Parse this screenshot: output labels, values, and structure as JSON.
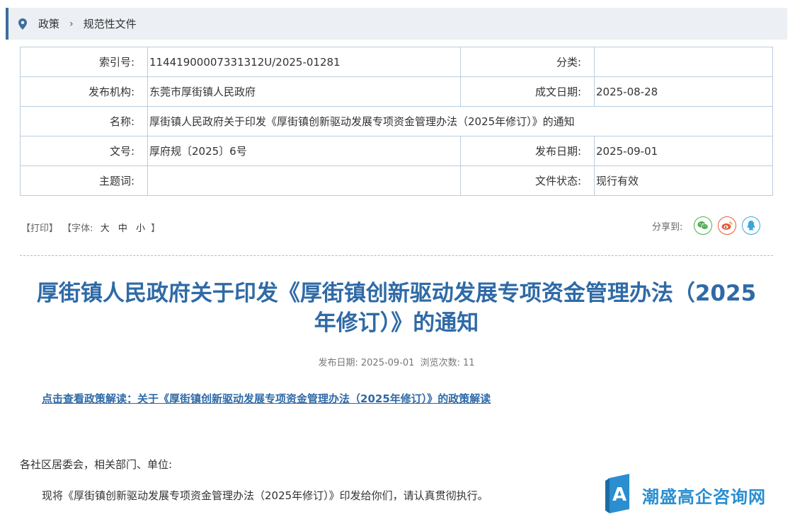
{
  "breadcrumb": {
    "items": [
      "政策",
      "规范性文件"
    ],
    "separator": "›"
  },
  "meta": {
    "index_no_label": "索引号:",
    "index_no": "11441900007331312U/2025-01281",
    "category_label": "分类:",
    "category": "",
    "publisher_label": "发布机构:",
    "publisher": "东莞市厚街镇人民政府",
    "written_date_label": "成文日期:",
    "written_date": "2025-08-28",
    "name_label": "名称:",
    "name": "厚街镇人民政府关于印发《厚街镇创新驱动发展专项资金管理办法（2025年修订）》的通知",
    "doc_no_label": "文号:",
    "doc_no": "厚府规〔2025〕6号",
    "publish_date_label": "发布日期:",
    "publish_date": "2025-09-01",
    "keywords_label": "主题词:",
    "keywords": "",
    "status_label": "文件状态:",
    "status": "现行有效"
  },
  "tools": {
    "print": "【打印】",
    "font_open": "【字体:",
    "font_large": "大",
    "font_medium": "中",
    "font_small": "小",
    "font_close": "】",
    "share_label": "分享到:"
  },
  "icons": {
    "wechat": "wechat-icon",
    "weibo": "weibo-icon",
    "qq": "qq-icon",
    "location": "location-pin-icon"
  },
  "article": {
    "title_line1": "厚街镇人民政府关于印发《厚街镇创新驱动发展专项资金管理办法（2025",
    "title_line2": "年修订）》的通知",
    "pub_date_label": "发布日期:",
    "pub_date": "2025-09-01",
    "views_label": "浏览次数:",
    "views": "11",
    "interpretation_link": "点击查看政策解读：关于《厚街镇创新驱动发展专项资金管理办法（2025年修订）》的政策解读",
    "greeting": "各社区居委会，相关部门、单位:",
    "body_para1": "现将《厚街镇创新驱动发展专项资金管理办法（2025年修订）》印发给你们，请认真贯彻执行。"
  },
  "watermark": {
    "text": "潮盛高企咨询网"
  },
  "colors": {
    "accent": "#2f6aa6",
    "breadcrumb_bg": "#eceff3",
    "table_border": "#b9cde0",
    "watermark": "#2a8ed0"
  }
}
